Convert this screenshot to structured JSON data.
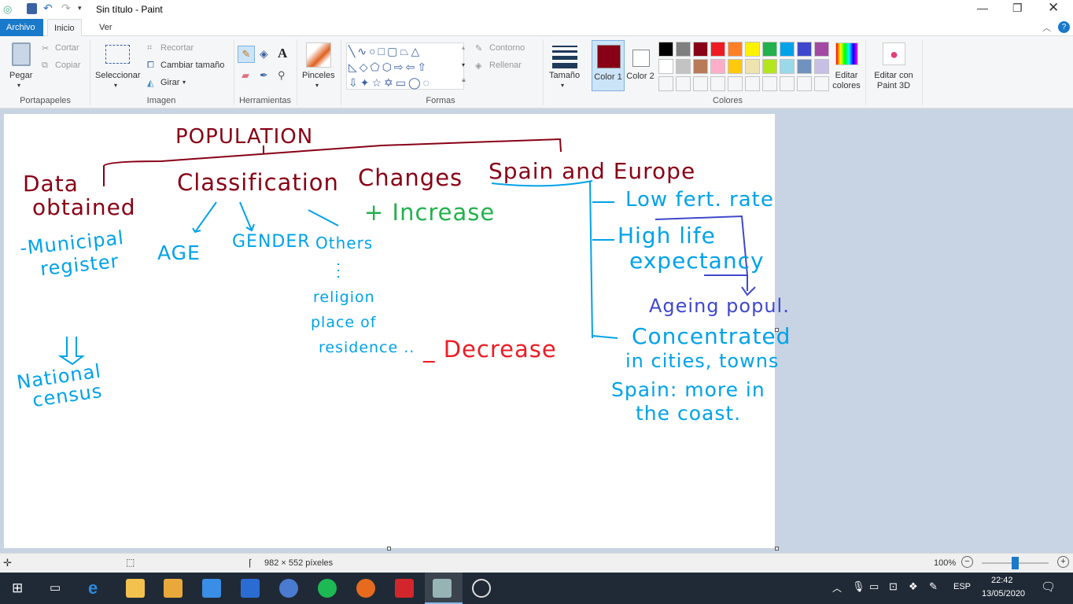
{
  "window": {
    "title": "Sin título - Paint"
  },
  "tabs": [
    "Archivo",
    "Inicio",
    "Ver"
  ],
  "ribbon": {
    "portapapeles": {
      "label": "Portapapeles",
      "paste": "Pegar",
      "cut": "Cortar",
      "copy": "Copiar"
    },
    "imagen": {
      "label": "Imagen",
      "select": "Seleccionar",
      "crop": "Recortar",
      "resize": "Cambiar tamaño",
      "rotate": "Girar"
    },
    "herramientas": {
      "label": "Herramientas"
    },
    "pinceles": "Pinceles",
    "formas": {
      "label": "Formas",
      "outline": "Contorno",
      "fill": "Rellenar"
    },
    "size": "Tamaño",
    "color1": "Color 1",
    "color2": "Color 2",
    "colores": "Colores",
    "edit_colors": "Editar colores",
    "paint3d": "Editar con Paint 3D",
    "palette_row1": [
      "#000000",
      "#7f7f7f",
      "#880015",
      "#ed1c24",
      "#ff7f27",
      "#fff200",
      "#22b14c",
      "#00a2e8",
      "#3f48cc",
      "#a349a4"
    ],
    "palette_row2": [
      "#ffffff",
      "#c3c3c3",
      "#b97a57",
      "#ffaec9",
      "#ffc90e",
      "#efe4b0",
      "#b5e61d",
      "#99d9ea",
      "#7092be",
      "#c8bfe7"
    ],
    "color1_value": "#880015",
    "color2_value": "#ffffff"
  },
  "drawing": {
    "title": "POPULATION",
    "data_obtained": [
      "Data",
      "obtained"
    ],
    "municipal": [
      "-Municipal",
      "register"
    ],
    "national": [
      "National",
      "census"
    ],
    "classification": "Classification",
    "age": "AGE",
    "gender": "GENDER",
    "others": "Others",
    "others_list": [
      "religion",
      "place of",
      "residence .."
    ],
    "changes": "Changes",
    "increase": "+ Increase",
    "decrease": "_ Decrease",
    "spain_europe": "Spain and Europe",
    "low_fert": "Low fert. rate",
    "high_life": [
      "High life",
      "expectancy"
    ],
    "ageing": "Ageing popul.",
    "concentrated": [
      "Concentrated",
      "in cities, towns"
    ],
    "spain_coast": [
      "Spain: more in",
      "the coast."
    ]
  },
  "status": {
    "dimensions": "982 × 552 píxeles",
    "zoom": "100%",
    "zoom_level": 100
  },
  "taskbar": {
    "lang": "ESP",
    "time": "22:42",
    "date": "13/05/2020"
  }
}
